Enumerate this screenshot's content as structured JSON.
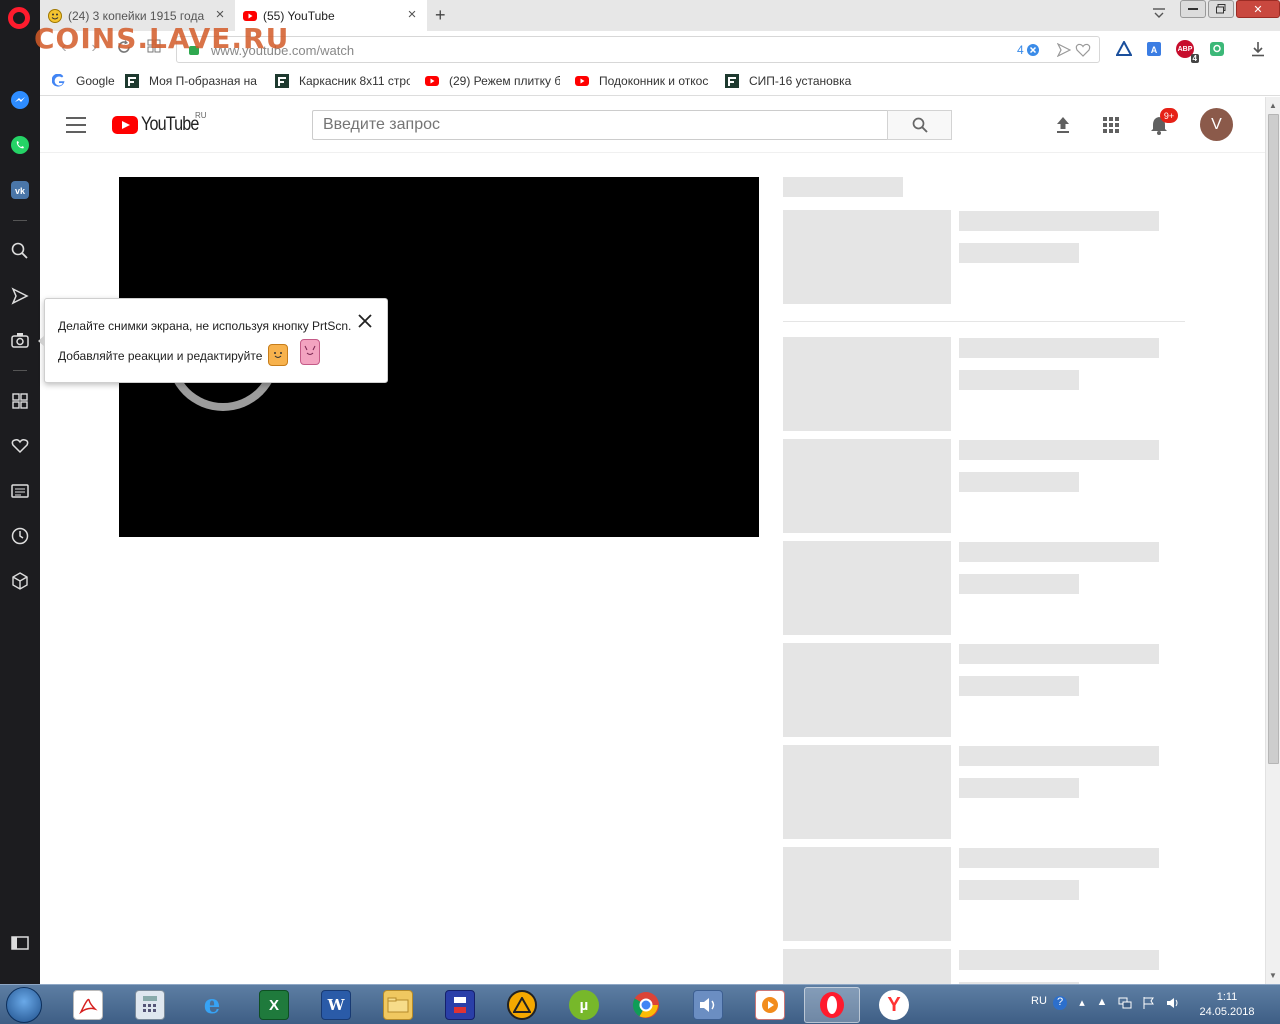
{
  "watermark": "COINS.LAVE.RU",
  "tabs": [
    {
      "title": "(24) 3 копейки 1915 года",
      "active": false
    },
    {
      "title": "(55) YouTube",
      "active": true
    }
  ],
  "address": {
    "url": "www.youtube.com/watch",
    "adblock_count": "4"
  },
  "extensions": {
    "abp_label": "ABP",
    "abp_badge": "4"
  },
  "bookmarks": [
    {
      "label": "Google",
      "icon": "google-icon"
    },
    {
      "label": "Моя П-образная на",
      "icon": "forumhouse-icon"
    },
    {
      "label": "Каркасник 8х11 стро",
      "icon": "forumhouse-icon"
    },
    {
      "label": "(29) Режем плитку бо",
      "icon": "youtube-icon"
    },
    {
      "label": "Подоконник и откос",
      "icon": "youtube-icon"
    },
    {
      "label": "СИП-16 установка",
      "icon": "forumhouse-icon"
    }
  ],
  "youtube": {
    "wordmark": "YouTube",
    "region": "RU",
    "search_placeholder": "Введите запрос",
    "notifications_badge": "9+",
    "avatar_letter": "V"
  },
  "tooltip": {
    "line1": "Делайте снимки экрана, не используя кнопку PrtScn.",
    "line2": "Добавляйте реакции и редактируйте"
  },
  "taskbar": {
    "lang": "RU",
    "time": "1:11",
    "date": "24.05.2018"
  },
  "colors": {
    "youtube_red": "#ff0000",
    "opera_red": "#ff1b2d",
    "sidebar_bg": "#1c1c1f",
    "skeleton": "#e5e5e5"
  }
}
